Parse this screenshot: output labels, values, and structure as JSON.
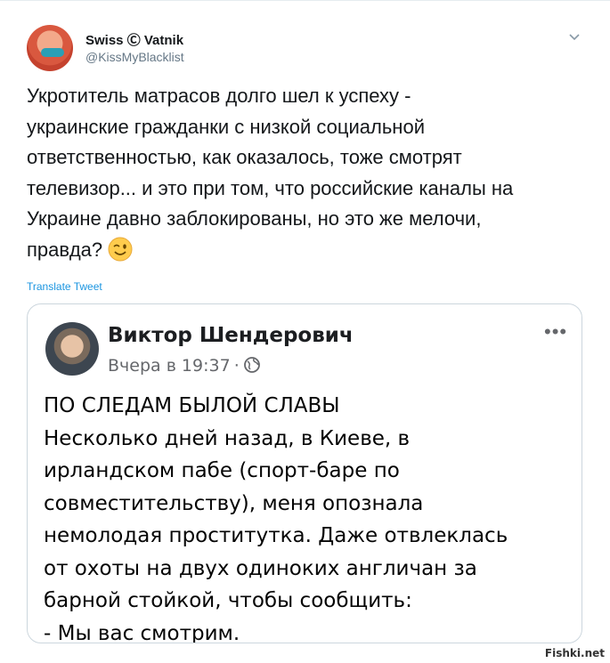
{
  "tweet": {
    "author_name": "Swiss Ⓒ Vatnik",
    "author_handle": "@KissMyBlacklist",
    "text": "Укротитель матрасов долго шел к успеху -\nукраинские гражданки с низкой социальной\nответственностью, как оказалось, тоже смотрят\nтелевизор... и это при том, что российские каналы на\nУкраине давно заблокированы, но это же мелочи,\nправда?",
    "emoji": "winking-face",
    "translate_label": "Translate Tweet"
  },
  "quoted_post": {
    "author_name": "Виктор Шендерович",
    "time": "Вчера в 19:37",
    "separator": "·",
    "more_label": "•••",
    "lines": [
      "ПО СЛЕДАМ БЫЛОЙ СЛАВЫ",
      "Несколько дней назад, в Киеве, в",
      "ирландском пабе (спорт-баре по",
      "совместительству), меня опознала",
      "немолодая проститутка. Даже отвлеклась",
      "от охоты на двух одиноких англичан за",
      "барной стойкой, чтобы сообщить:",
      "- Мы вас смотрим."
    ]
  },
  "watermark": "Fishki.net",
  "colors": {
    "link_blue": "#1b95e0",
    "secondary_text": "#657786",
    "border": "#ccd6dd"
  }
}
